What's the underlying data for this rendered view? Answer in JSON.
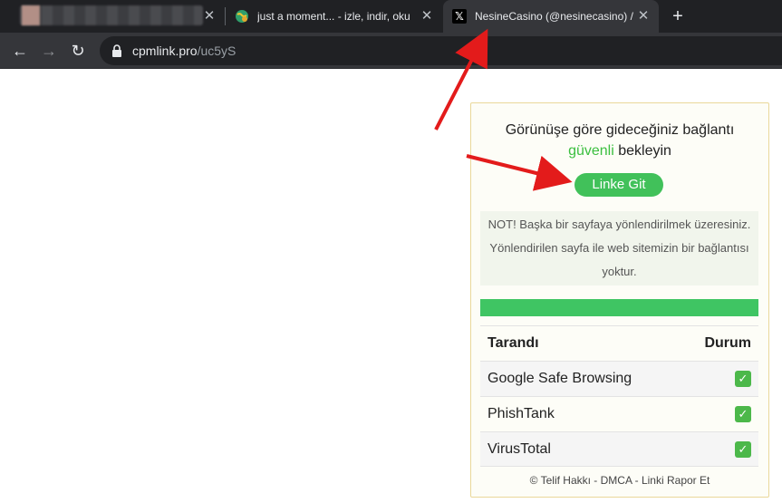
{
  "browser": {
    "tabs": [
      {
        "title": "",
        "blurred": true
      },
      {
        "title": "just a moment... - izle, indir, oku"
      },
      {
        "title": "NesineCasino (@nesinecasino) /"
      }
    ],
    "close_glyph": "✕",
    "new_tab_glyph": "+",
    "address": {
      "host": "cpmlink.pro",
      "path": "/uc5yS"
    }
  },
  "card": {
    "headline_part1": "Görünüşe göre gideceğiniz bağlantı",
    "headline_safe": "güvenli",
    "headline_part2": " bekleyin",
    "go_button": "Linke Git",
    "notice": "NOT! Başka bir sayfaya yönlendirilmek üzeresiniz. Yönlendirilen sayfa ile web sitemizin bir bağlantısı yoktur.",
    "progress": 1.0,
    "table": {
      "col_scanned": "Tarandı",
      "col_status": "Durum",
      "rows": [
        {
          "name": "Google Safe Browsing",
          "status": "✓"
        },
        {
          "name": "PhishTank",
          "status": "✓"
        },
        {
          "name": "VirusTotal",
          "status": "✓"
        }
      ]
    },
    "footer": "© Telif Hakkı - DMCA - Linki Rapor Et"
  },
  "colors": {
    "safe_green": "#3bbf3f",
    "button_green": "#41c15a",
    "arrow_red": "#e31b1b"
  }
}
